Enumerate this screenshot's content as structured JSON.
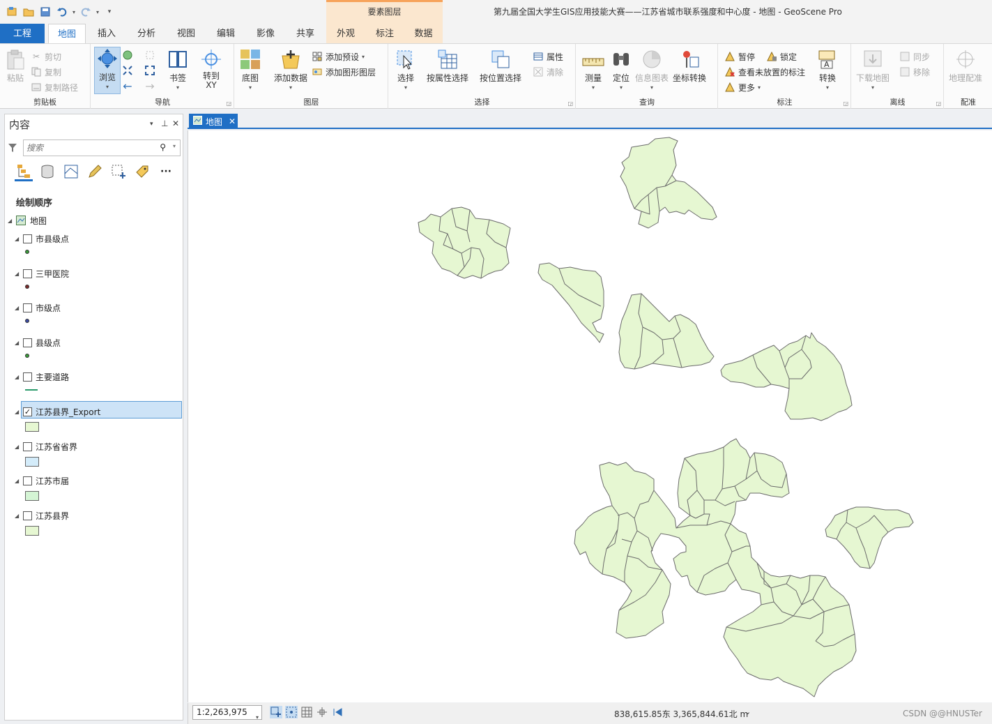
{
  "window": {
    "title": "第九届全国大学生GIS应用技能大赛——江苏省城市联系强度和中心度 - 地图 - GeoScene Pro"
  },
  "quick_access": [
    "new-project-icon",
    "open-project-icon",
    "save-project-icon",
    "undo-icon",
    "redo-icon",
    "customize-icon"
  ],
  "contextual": {
    "label": "要素图层"
  },
  "ribbon_tabs": [
    {
      "label": "工程",
      "name": "tab-project"
    },
    {
      "label": "地图",
      "name": "tab-map"
    },
    {
      "label": "插入",
      "name": "tab-insert"
    },
    {
      "label": "分析",
      "name": "tab-analysis"
    },
    {
      "label": "视图",
      "name": "tab-view"
    },
    {
      "label": "编辑",
      "name": "tab-edit"
    },
    {
      "label": "影像",
      "name": "tab-imagery"
    },
    {
      "label": "共享",
      "name": "tab-share"
    },
    {
      "label": "外观",
      "name": "tab-appearance"
    },
    {
      "label": "标注",
      "name": "tab-labeling"
    },
    {
      "label": "数据",
      "name": "tab-data"
    }
  ],
  "ribbon": {
    "clipboard": {
      "label": "剪贴板",
      "paste": "粘贴",
      "cut": "剪切",
      "copy": "复制",
      "copy_path": "复制路径"
    },
    "navigate": {
      "label": "导航",
      "explore": "浏览",
      "bookmarks": "书签",
      "goto_xy": "转到\nXY"
    },
    "layer": {
      "label": "图层",
      "basemap": "底图",
      "add_data": "添加数据",
      "add_preset": "添加预设",
      "add_graphics_layer": "添加图形图层"
    },
    "selection": {
      "label": "选择",
      "select": "选择",
      "select_by_attributes": "按属性选择",
      "select_by_location": "按位置选择",
      "attributes": "属性",
      "clear": "清除"
    },
    "inquiry": {
      "label": "查询",
      "measure": "测量",
      "locate": "定位",
      "infographics": "信息图表",
      "coordinate_conversion": "坐标转换"
    },
    "labeling": {
      "label": "标注",
      "pause": "暂停",
      "lock": "锁定",
      "view_unplaced": "查看未放置的标注",
      "more": "更多",
      "convert": "转换"
    },
    "offline": {
      "label": "离线",
      "download_map": "下载地图",
      "sync": "同步",
      "remove": "移除"
    },
    "georeference": {
      "label": "配准",
      "georeference": "地理配准"
    }
  },
  "contents": {
    "title": "内容",
    "search_placeholder": "搜索",
    "section": "绘制顺序",
    "map_name": "地图",
    "layers": [
      {
        "name": "市县级点",
        "checked": false,
        "symbol": "point",
        "color": "#3a9a3a"
      },
      {
        "name": "三甲医院",
        "checked": false,
        "symbol": "point",
        "color": "#7a2a2a"
      },
      {
        "name": "市级点",
        "checked": false,
        "symbol": "point",
        "color": "#3a4aa0"
      },
      {
        "name": "县级点",
        "checked": false,
        "symbol": "point",
        "color": "#3a9a3a"
      },
      {
        "name": "主要道路",
        "checked": false,
        "symbol": "line",
        "color": "#2a9a6a"
      },
      {
        "name": "江苏县界_Export",
        "checked": true,
        "symbol": "polygon",
        "color": "#e6f7d2",
        "selected": true
      },
      {
        "name": "江苏省省界",
        "checked": false,
        "symbol": "polygon",
        "color": "#d4ecfa"
      },
      {
        "name": "江苏市届",
        "checked": false,
        "symbol": "polygon",
        "color": "#d4f4d4"
      },
      {
        "name": "江苏县界",
        "checked": false,
        "symbol": "polygon",
        "color": "#e6f7d2"
      }
    ]
  },
  "map_view": {
    "tab_label": "地图",
    "fill_color": "#e6f7d2",
    "outline_color": "#6a6a6a"
  },
  "status": {
    "scale": "1:2,263,975",
    "coordinates": "838,615.85东 3,365,844.61北 m",
    "watermark": "CSDN @@HNUSTer"
  }
}
